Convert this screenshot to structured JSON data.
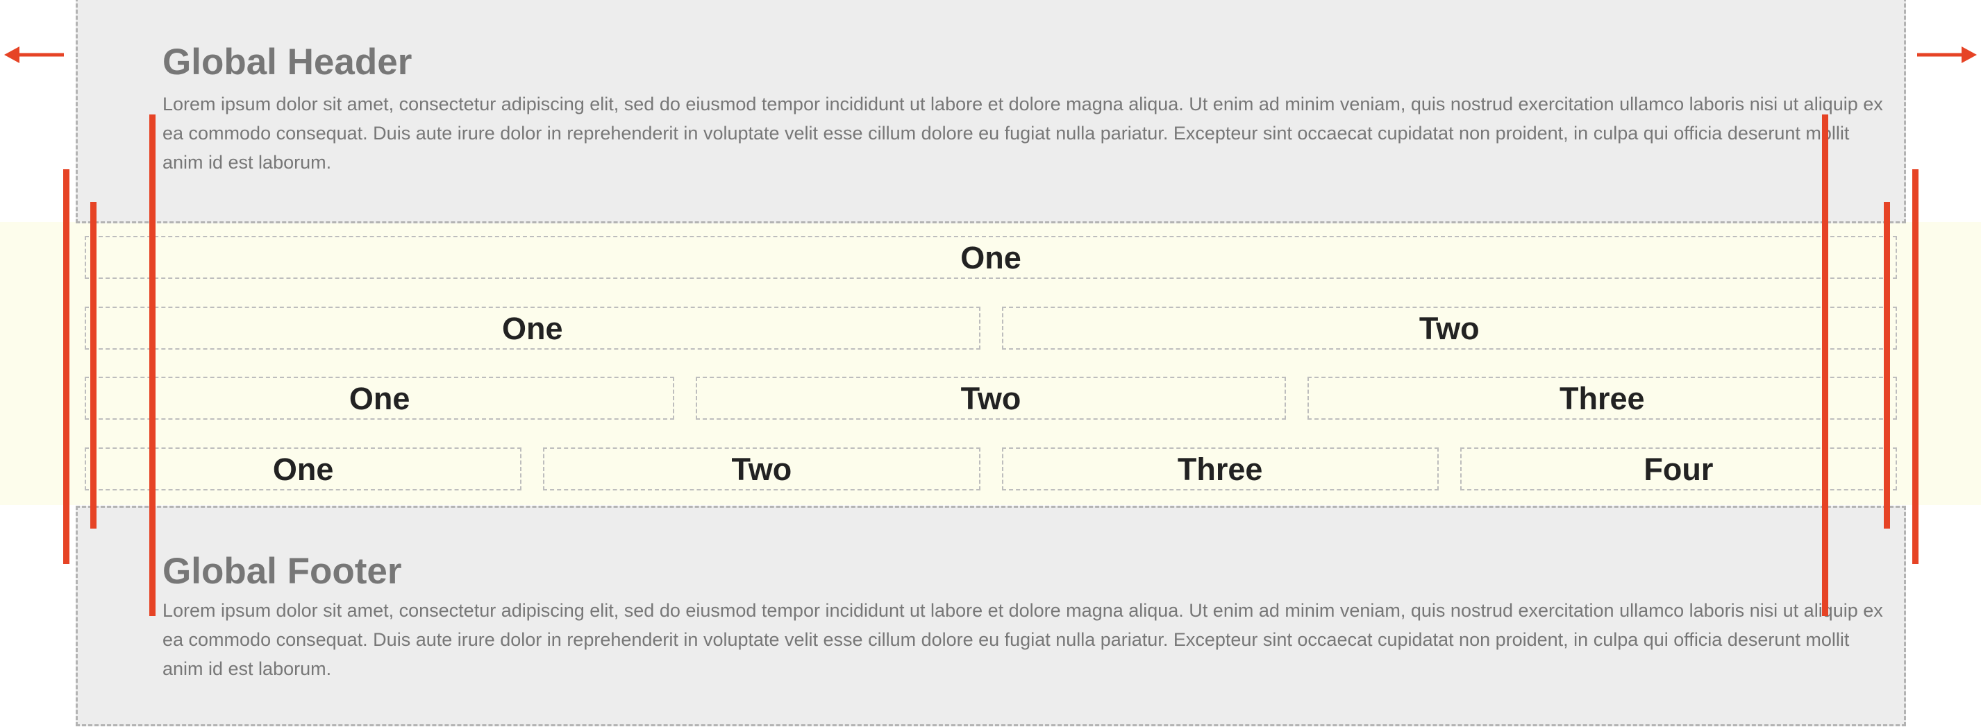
{
  "header": {
    "title": "Global Header",
    "text": "Lorem ipsum dolor sit amet, consectetur adipiscing elit, sed do eiusmod tempor incididunt ut labore et dolore magna aliqua. Ut enim ad minim veniam, quis nostrud exercitation ullamco laboris nisi ut aliquip ex ea commodo consequat. Duis aute irure dolor in reprehenderit in voluptate velit esse cillum dolore eu fugiat nulla pariatur. Excepteur sint occaecat cupidatat non proident, in culpa qui officia deserunt mollit anim id est laborum."
  },
  "grid": {
    "rows": [
      [
        "One"
      ],
      [
        "One",
        "Two"
      ],
      [
        "One",
        "Two",
        "Three"
      ],
      [
        "One",
        "Two",
        "Three",
        "Four"
      ]
    ]
  },
  "footer": {
    "title": "Global Footer",
    "text": "Lorem ipsum dolor sit amet, consectetur adipiscing elit, sed do eiusmod tempor incididunt ut labore et dolore magna aliqua. Ut enim ad minim veniam, quis nostrud exercitation ullamco laboris nisi ut aliquip ex ea commodo consequat. Duis aute irure dolor in reprehenderit in voluptate velit esse cillum dolore eu fugiat nulla pariatur. Excepteur sint occaecat cupidatat non proident, in culpa qui officia deserunt mollit anim id est laborum."
  },
  "colors": {
    "accent_red": "#e64325",
    "block_background": "#ededed",
    "content_background": "#fdfdec",
    "dashed_border": "#b3b3b3",
    "muted_text": "#777777",
    "cell_text": "#222222"
  },
  "icons": {
    "left": "arrow-left-icon",
    "right": "arrow-right-icon"
  }
}
